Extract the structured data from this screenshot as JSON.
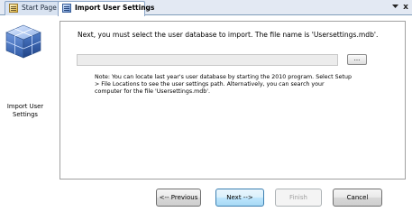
{
  "tabs": [
    {
      "label": "Start Page",
      "icon": "start-page-icon"
    },
    {
      "label": "Import User Settings",
      "icon": "import-settings-icon"
    }
  ],
  "strip": {
    "dropdown_icon": "chevron-down-icon",
    "close_glyph": "x",
    "close_icon": "close-icon"
  },
  "sidebar": {
    "label": "Import User Settings",
    "icon": "database-cubes-icon"
  },
  "main": {
    "instruction": "Next, you must select the user database to import. The file name is 'Usersettings.mdb'.",
    "path_value": "",
    "browse_label": "...",
    "note": "Note: You can locate last year's user database by starting the 2010 program. Select Setup > File Locations to see the user settings path. Alternatively, you can search your computer for the file 'Usersettings.mdb'."
  },
  "buttons": {
    "previous": "<-- Previous",
    "next": "Next -->",
    "finish": "Finish",
    "cancel": "Cancel"
  },
  "colors": {
    "cube_blue": "#4a78c2",
    "tab_strip": "#e3e9f3",
    "next_focus": "#3c7fb1"
  }
}
